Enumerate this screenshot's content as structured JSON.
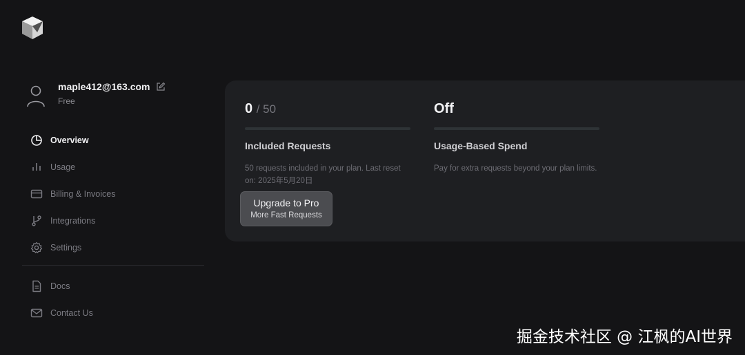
{
  "user": {
    "email": "maple412@163.com",
    "plan": "Free"
  },
  "nav": {
    "items": [
      {
        "label": "Overview",
        "icon": "pie-chart-icon",
        "active": true
      },
      {
        "label": "Usage",
        "icon": "bar-chart-icon",
        "active": false
      },
      {
        "label": "Billing & Invoices",
        "icon": "credit-card-icon",
        "active": false
      },
      {
        "label": "Integrations",
        "icon": "git-branch-icon",
        "active": false
      },
      {
        "label": "Settings",
        "icon": "gear-icon",
        "active": false
      }
    ],
    "secondary": [
      {
        "label": "Docs",
        "icon": "document-icon"
      },
      {
        "label": "Contact Us",
        "icon": "mail-icon"
      }
    ]
  },
  "stats": {
    "included": {
      "used": "0",
      "total": "/ 50",
      "progress": 0,
      "title": "Included Requests",
      "description": "50 requests included in your plan. Last reset on: 2025年5月20日"
    },
    "usage_based": {
      "value": "Off",
      "progress": 0,
      "title": "Usage-Based Spend",
      "description": "Pay for extra requests beyond your plan limits."
    }
  },
  "upgrade": {
    "title": "Upgrade to Pro",
    "subtitle": "More Fast Requests"
  },
  "watermark": "掘金技术社区 @ 江枫的AI世界",
  "colors": {
    "background": "#141416",
    "card": "#1e1f22",
    "button": "#4b4c50",
    "progress_track": "#2e3336"
  }
}
